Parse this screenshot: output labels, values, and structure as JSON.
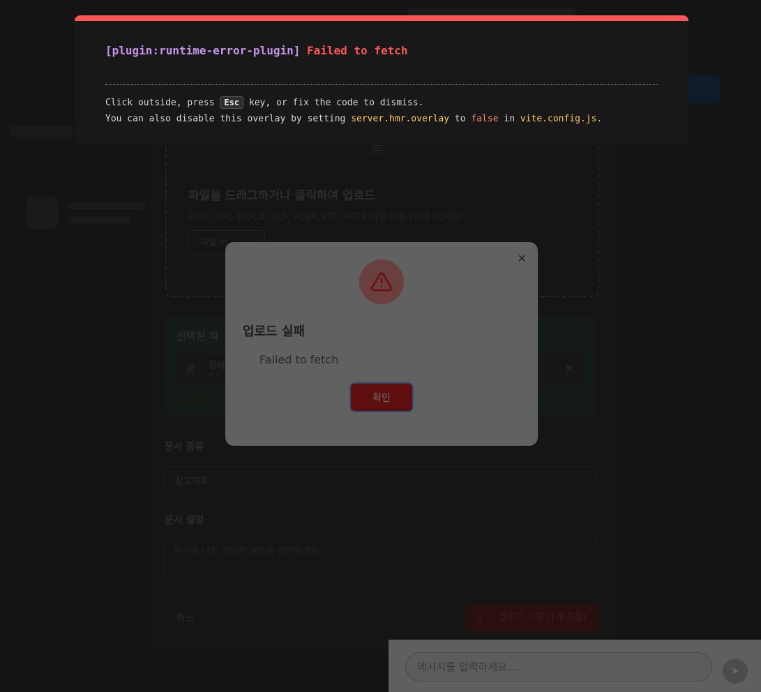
{
  "vite_overlay": {
    "plugin": "[plugin:runtime-error-plugin]",
    "message": "Failed to fetch",
    "tip1_a": "Click outside, press",
    "tip1_key": "Esc",
    "tip1_b": "key, or fix the code to dismiss.",
    "tip2_a": "You can also disable this overlay by setting",
    "tip2_code": "server.hmr.overlay",
    "tip2_b": "to",
    "tip2_false": "false",
    "tip2_c": "in",
    "tip2_file": "vite.config.js",
    "tip2_d": ".",
    "accent_color": "#ff5555"
  },
  "alert": {
    "title": "업로드 실패",
    "message": "Failed to fetch",
    "confirm_label": "확인",
    "icon": "warning-icon",
    "close_icon": "close-icon"
  },
  "upload_modal": {
    "dropzone_title": "파일을 드래그하거나 클릭하여 업로드",
    "dropzone_subtitle": "PDF, DOC, DOCX, XLS, XLSX, PPT, PPTX 파일 지원 (최대 50MB)",
    "select_button": "파일 선",
    "selected_title": "선택된 파",
    "file_name": "갈리",
    "file_size": "0.9",
    "clear_all": "모두 제거",
    "doc_type_label": "문서 종류",
    "doc_type_value": "참고자료",
    "description_label": "문서 설명",
    "description_placeholder": "문서에 대한 간단한 설명을 입력하세요...",
    "cancel_label": "취소",
    "start_label": "업로드 시작 (1개 파일)"
  },
  "chat": {
    "placeholder": "메시지를 입력하세요...",
    "send_icon": "send-icon"
  }
}
